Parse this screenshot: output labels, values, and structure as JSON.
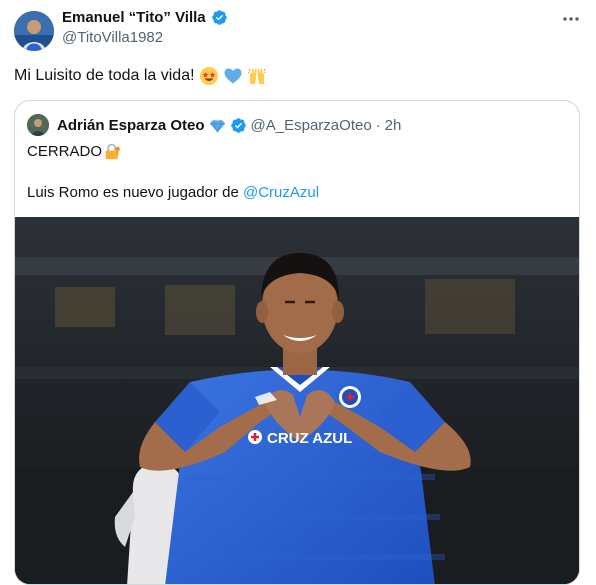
{
  "author": {
    "name": "Emanuel “Tito” Villa",
    "handle": "@TitoVilla1982"
  },
  "tweet": {
    "text": "Mi Luisito de toda la vida!",
    "emojis": [
      "star-struck-emoji",
      "blue-heart-emoji",
      "raising-hands-emoji"
    ]
  },
  "quoted": {
    "author_name": "Adrián Esparza Oteo",
    "handle": "@A_EsparzaOteo",
    "dot": "·",
    "time": "2h",
    "line1": "CERRADO",
    "line2_prefix": "Luis Romo es nuevo jugador de ",
    "mention": "@CruzAzul"
  },
  "media": {
    "jersey_text": "CRUZ AZUL"
  },
  "colors": {
    "verified_blue": "#1d9bf0",
    "jersey_blue": "#2a63d6",
    "handle_gray": "#536471"
  }
}
